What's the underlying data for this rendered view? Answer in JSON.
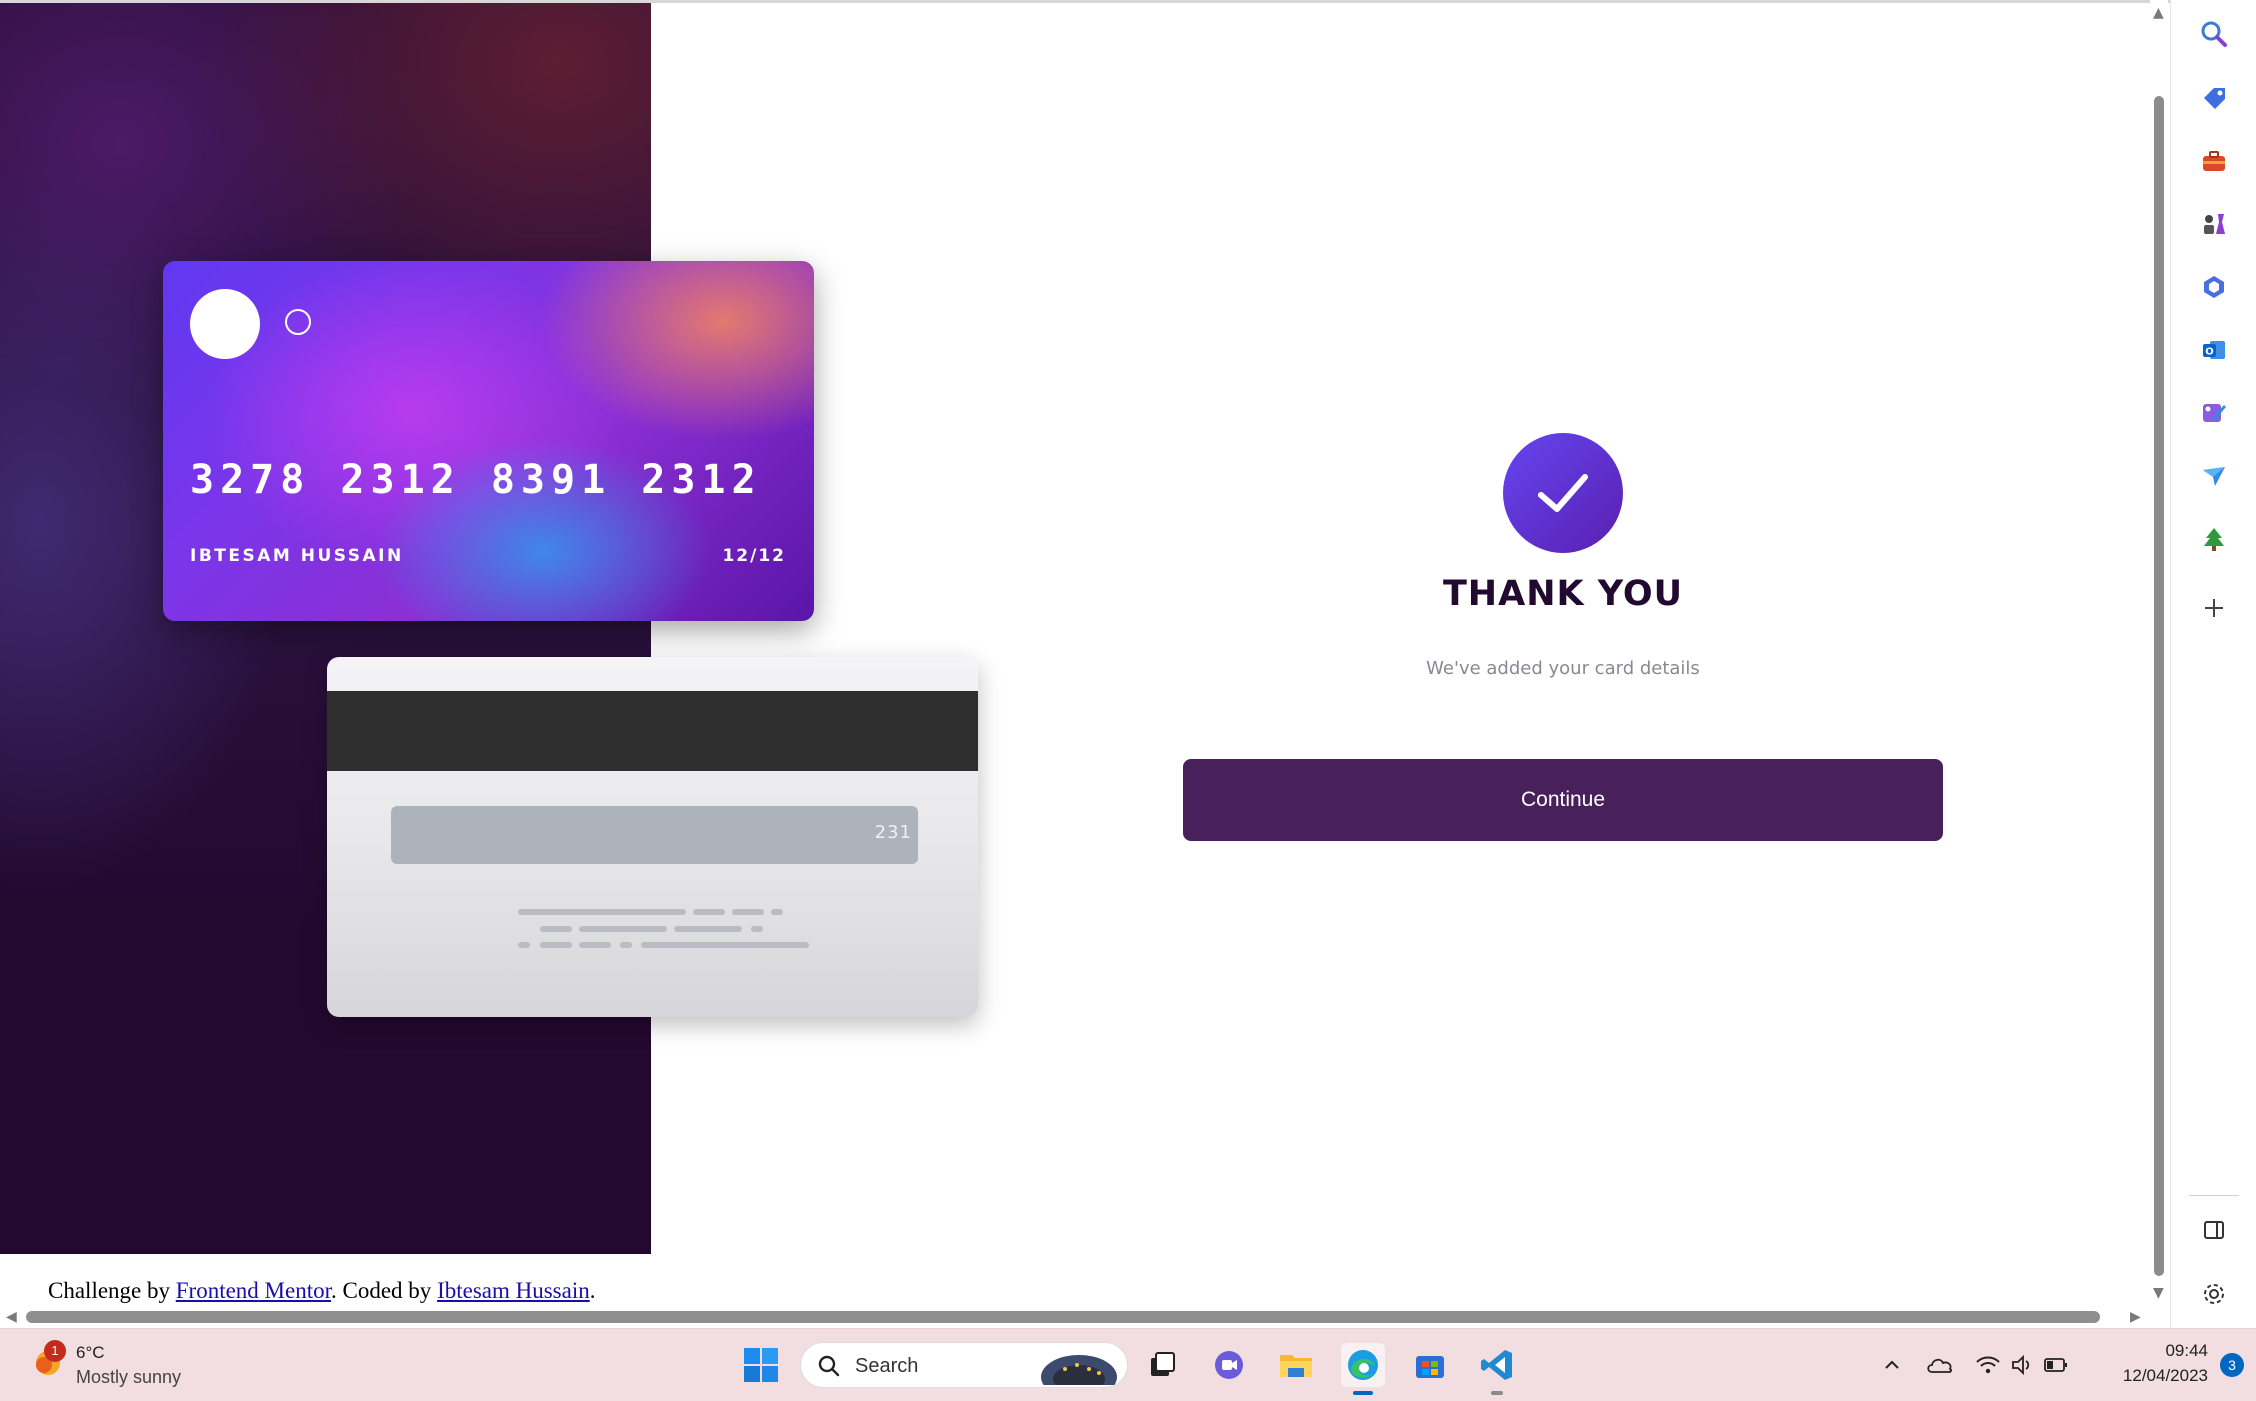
{
  "card_front": {
    "number": "3278 2312 8391 2312",
    "holder": "IBTESAM HUSSAIN",
    "expiry": "12/12"
  },
  "card_back": {
    "cvc": "231"
  },
  "success": {
    "title": "THANK YOU",
    "subtitle": "We've added your card details",
    "button_label": "Continue"
  },
  "attribution": {
    "prefix": "Challenge by ",
    "link1": "Frontend Mentor",
    "middle": ". Coded by ",
    "link2": "Ibtesam Hussain",
    "suffix": "."
  },
  "sidebar": {
    "icons": [
      "search-icon",
      "tag-icon",
      "briefcase-icon",
      "chess-icon",
      "microsoft365-icon",
      "outlook-icon",
      "designer-icon",
      "send-icon",
      "tree-icon",
      "add-icon",
      "split-screen-icon",
      "settings-icon"
    ]
  },
  "taskbar": {
    "weather_temp": "6°C",
    "weather_desc": "Mostly sunny",
    "weather_badge": "1",
    "search_placeholder": "Search",
    "time": "09:44",
    "date": "12/04/2023",
    "notification_count": "3"
  },
  "colors": {
    "primary_dark": "#47205c",
    "title_text": "#21092f",
    "muted_text": "#8e8593",
    "accent_gradient_start": "#6446f0",
    "accent_gradient_end": "#5a1fb0"
  }
}
